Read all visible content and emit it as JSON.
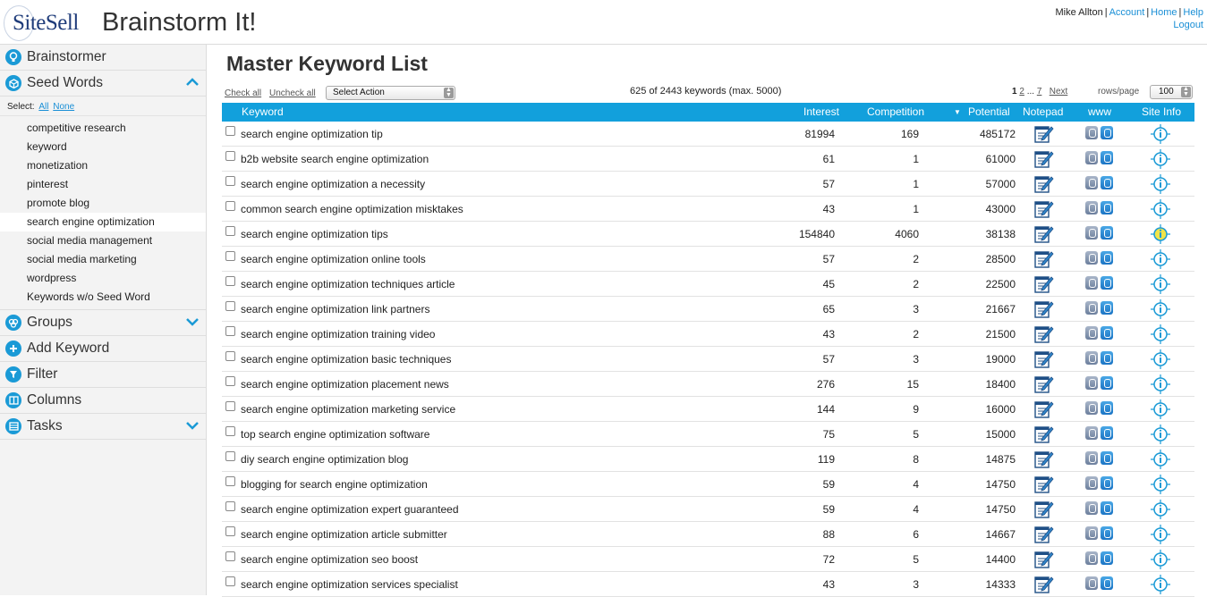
{
  "header": {
    "logo_text": "SiteSell",
    "app_title": "Brainstorm It!",
    "username": "Mike Allton",
    "links": [
      "Account",
      "Home",
      "Help"
    ],
    "logout": "Logout"
  },
  "sidebar": {
    "sections_top": [
      {
        "label": "Brainstormer",
        "icon": "lightbulb-icon"
      },
      {
        "label": "Seed Words",
        "icon": "cube-icon",
        "chevron": "up"
      }
    ],
    "select_label": "Select:",
    "select_all": "All",
    "select_none": "None",
    "seed_words": [
      "competitive research",
      "keyword",
      "monetization",
      "pinterest",
      "promote blog",
      "search engine optimization",
      "social media management",
      "social media marketing",
      "wordpress",
      "Keywords w/o Seed Word"
    ],
    "active_seed": 5,
    "sections_bottom": [
      {
        "label": "Groups",
        "icon": "groups-icon",
        "chevron": "down"
      },
      {
        "label": "Add Keyword",
        "icon": "plus-icon"
      },
      {
        "label": "Filter",
        "icon": "filter-icon"
      },
      {
        "label": "Columns",
        "icon": "columns-icon"
      },
      {
        "label": "Tasks",
        "icon": "tasks-icon",
        "chevron": "down"
      }
    ]
  },
  "main": {
    "title": "Master Keyword List",
    "check_all": "Check all",
    "uncheck_all": "Uncheck all",
    "action_select": "Select Action",
    "count_text": "625 of 2443 keywords (max. 5000)",
    "pager": {
      "current": "1",
      "page2": "2",
      "ellipsis": "...",
      "last": "7",
      "next": "Next"
    },
    "rows_label": "rows/page",
    "rows_value": "100",
    "columns": {
      "keyword": "Keyword",
      "interest": "Interest",
      "competition": "Competition",
      "potential": "Potential",
      "notepad": "Notepad",
      "www": "www",
      "siteinfo": "Site Info"
    },
    "sort_indicator": "▼",
    "rows": [
      {
        "keyword": "search engine optimization tip",
        "interest": "81994",
        "competition": "169",
        "potential": "485172"
      },
      {
        "keyword": "b2b website search engine optimization",
        "interest": "61",
        "competition": "1",
        "potential": "61000"
      },
      {
        "keyword": "search engine optimization a necessity",
        "interest": "57",
        "competition": "1",
        "potential": "57000"
      },
      {
        "keyword": "common search engine optimization misktakes",
        "interest": "43",
        "competition": "1",
        "potential": "43000"
      },
      {
        "keyword": "search engine optimization tips",
        "interest": "154840",
        "competition": "4060",
        "potential": "38138",
        "info_highlight": true
      },
      {
        "keyword": "search engine optimization online tools",
        "interest": "57",
        "competition": "2",
        "potential": "28500"
      },
      {
        "keyword": "search engine optimization techniques article",
        "interest": "45",
        "competition": "2",
        "potential": "22500"
      },
      {
        "keyword": "search engine optimization link partners",
        "interest": "65",
        "competition": "3",
        "potential": "21667"
      },
      {
        "keyword": "search engine optimization training video",
        "interest": "43",
        "competition": "2",
        "potential": "21500"
      },
      {
        "keyword": "search engine optimization basic techniques",
        "interest": "57",
        "competition": "3",
        "potential": "19000"
      },
      {
        "keyword": "search engine optimization placement news",
        "interest": "276",
        "competition": "15",
        "potential": "18400"
      },
      {
        "keyword": "search engine optimization marketing service",
        "interest": "144",
        "competition": "9",
        "potential": "16000"
      },
      {
        "keyword": "top search engine optimization software",
        "interest": "75",
        "competition": "5",
        "potential": "15000"
      },
      {
        "keyword": "diy search engine optimization blog",
        "interest": "119",
        "competition": "8",
        "potential": "14875"
      },
      {
        "keyword": "blogging for search engine optimization",
        "interest": "59",
        "competition": "4",
        "potential": "14750"
      },
      {
        "keyword": "search engine optimization expert guaranteed",
        "interest": "59",
        "competition": "4",
        "potential": "14750"
      },
      {
        "keyword": "search engine optimization article submitter",
        "interest": "88",
        "competition": "6",
        "potential": "14667"
      },
      {
        "keyword": "search engine optimization seo boost",
        "interest": "72",
        "competition": "5",
        "potential": "14400"
      },
      {
        "keyword": "search engine optimization services specialist",
        "interest": "43",
        "competition": "3",
        "potential": "14333"
      }
    ]
  },
  "colors": {
    "accent": "#12a0dc",
    "sidebar_bg": "#f3f3f3",
    "link": "#1a8fd6"
  }
}
